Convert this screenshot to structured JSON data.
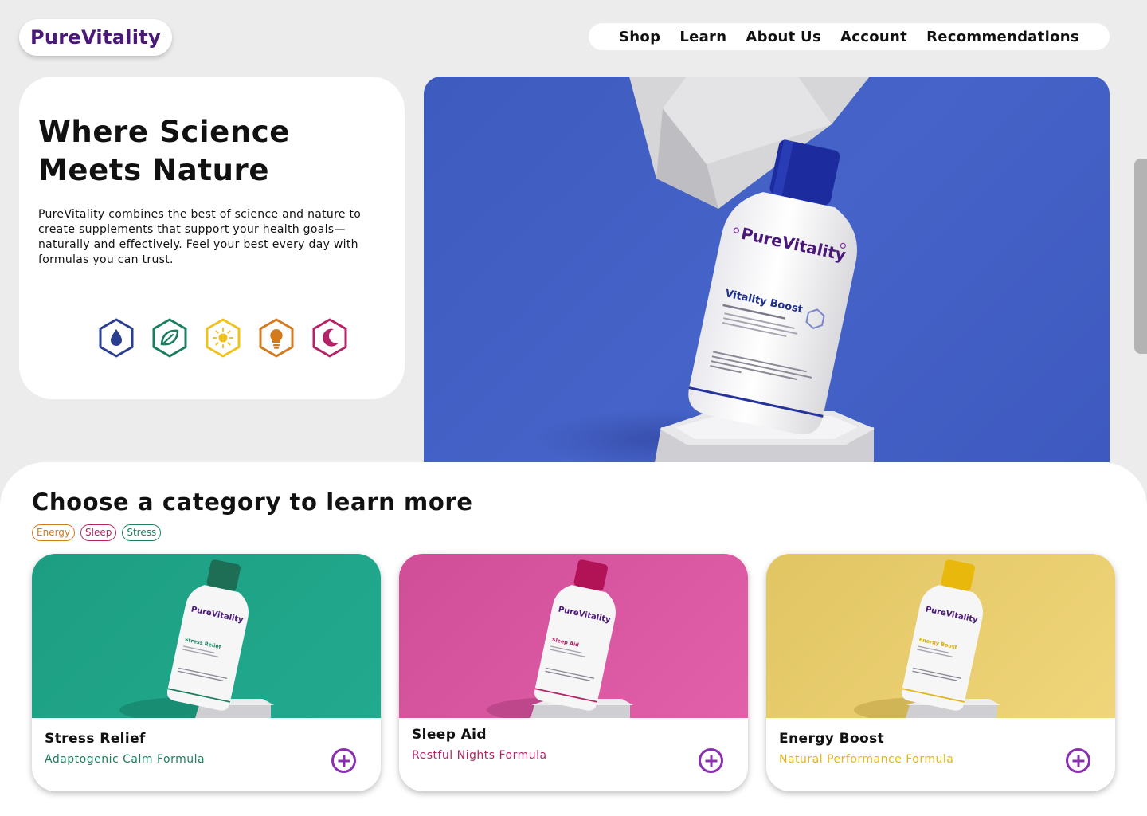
{
  "brand": {
    "name": "PureVitality",
    "color": "#4a1878"
  },
  "nav": {
    "items": [
      "Shop",
      "Learn",
      "About Us",
      "Account",
      "Recommendations"
    ]
  },
  "hero": {
    "title": "Where Science Meets Nature",
    "description": "PureVitality combines the best of science and nature to create supplements that support your health goals—naturally and effectively. Feel your best every day with formulas you can trust.",
    "icons": [
      "water-drop-icon",
      "leaf-icon",
      "sun-icon",
      "lightbulb-icon",
      "moon-icon"
    ],
    "image": {
      "product_name": "Vitality Boost",
      "background": "#4160c4"
    }
  },
  "categories": {
    "title": "Choose a category to learn more",
    "chips": [
      {
        "label": "Energy",
        "color": "#d27a1e"
      },
      {
        "label": "Sleep",
        "color": "#b22465"
      },
      {
        "label": "Stress",
        "color": "#1c7e60"
      }
    ],
    "cards": [
      {
        "title": "Stress Relief",
        "subtitle": "Adaptogenic Calm Formula",
        "accent": "#1c7e60",
        "bg": "#1fa689",
        "cap": "#1e6e55",
        "label": "Stress Relief"
      },
      {
        "title": "Sleep Aid",
        "subtitle": "Restful Nights Formula",
        "accent": "#b22465",
        "bg": "#d9559f",
        "cap": "#b11356",
        "label": "Sleep Aid"
      },
      {
        "title": "Energy Boost",
        "subtitle": "Natural Performance Formula",
        "accent": "#e3b417",
        "bg": "#e8cd6c",
        "cap": "#e8b80c",
        "label": "Energy Boost"
      }
    ]
  }
}
